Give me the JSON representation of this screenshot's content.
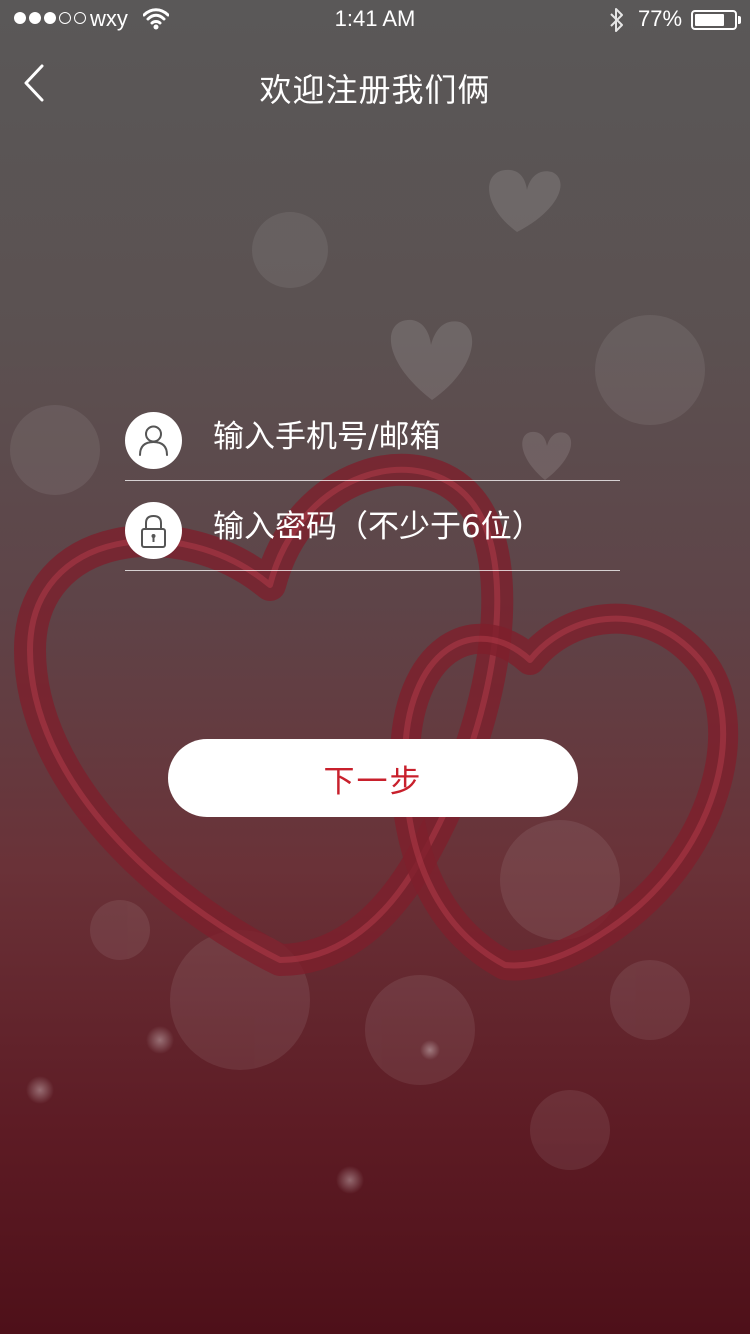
{
  "status_bar": {
    "carrier": "wxy",
    "time": "1:41 AM",
    "battery_percent_label": "77%",
    "battery_level": 0.77,
    "signal_bars_filled": 3,
    "signal_bars_total": 5
  },
  "nav": {
    "title": "欢迎注册我们俩",
    "back_icon": "chevron-left-icon"
  },
  "form": {
    "phone": {
      "placeholder": "输入手机号/邮箱",
      "value": "",
      "icon": "user-icon"
    },
    "password": {
      "placeholder": "输入密码（不少于6位）",
      "value": "",
      "icon": "lock-icon"
    },
    "next_label": "下一步"
  },
  "colors": {
    "accent": "#c8202c",
    "button_bg": "#ffffff"
  }
}
